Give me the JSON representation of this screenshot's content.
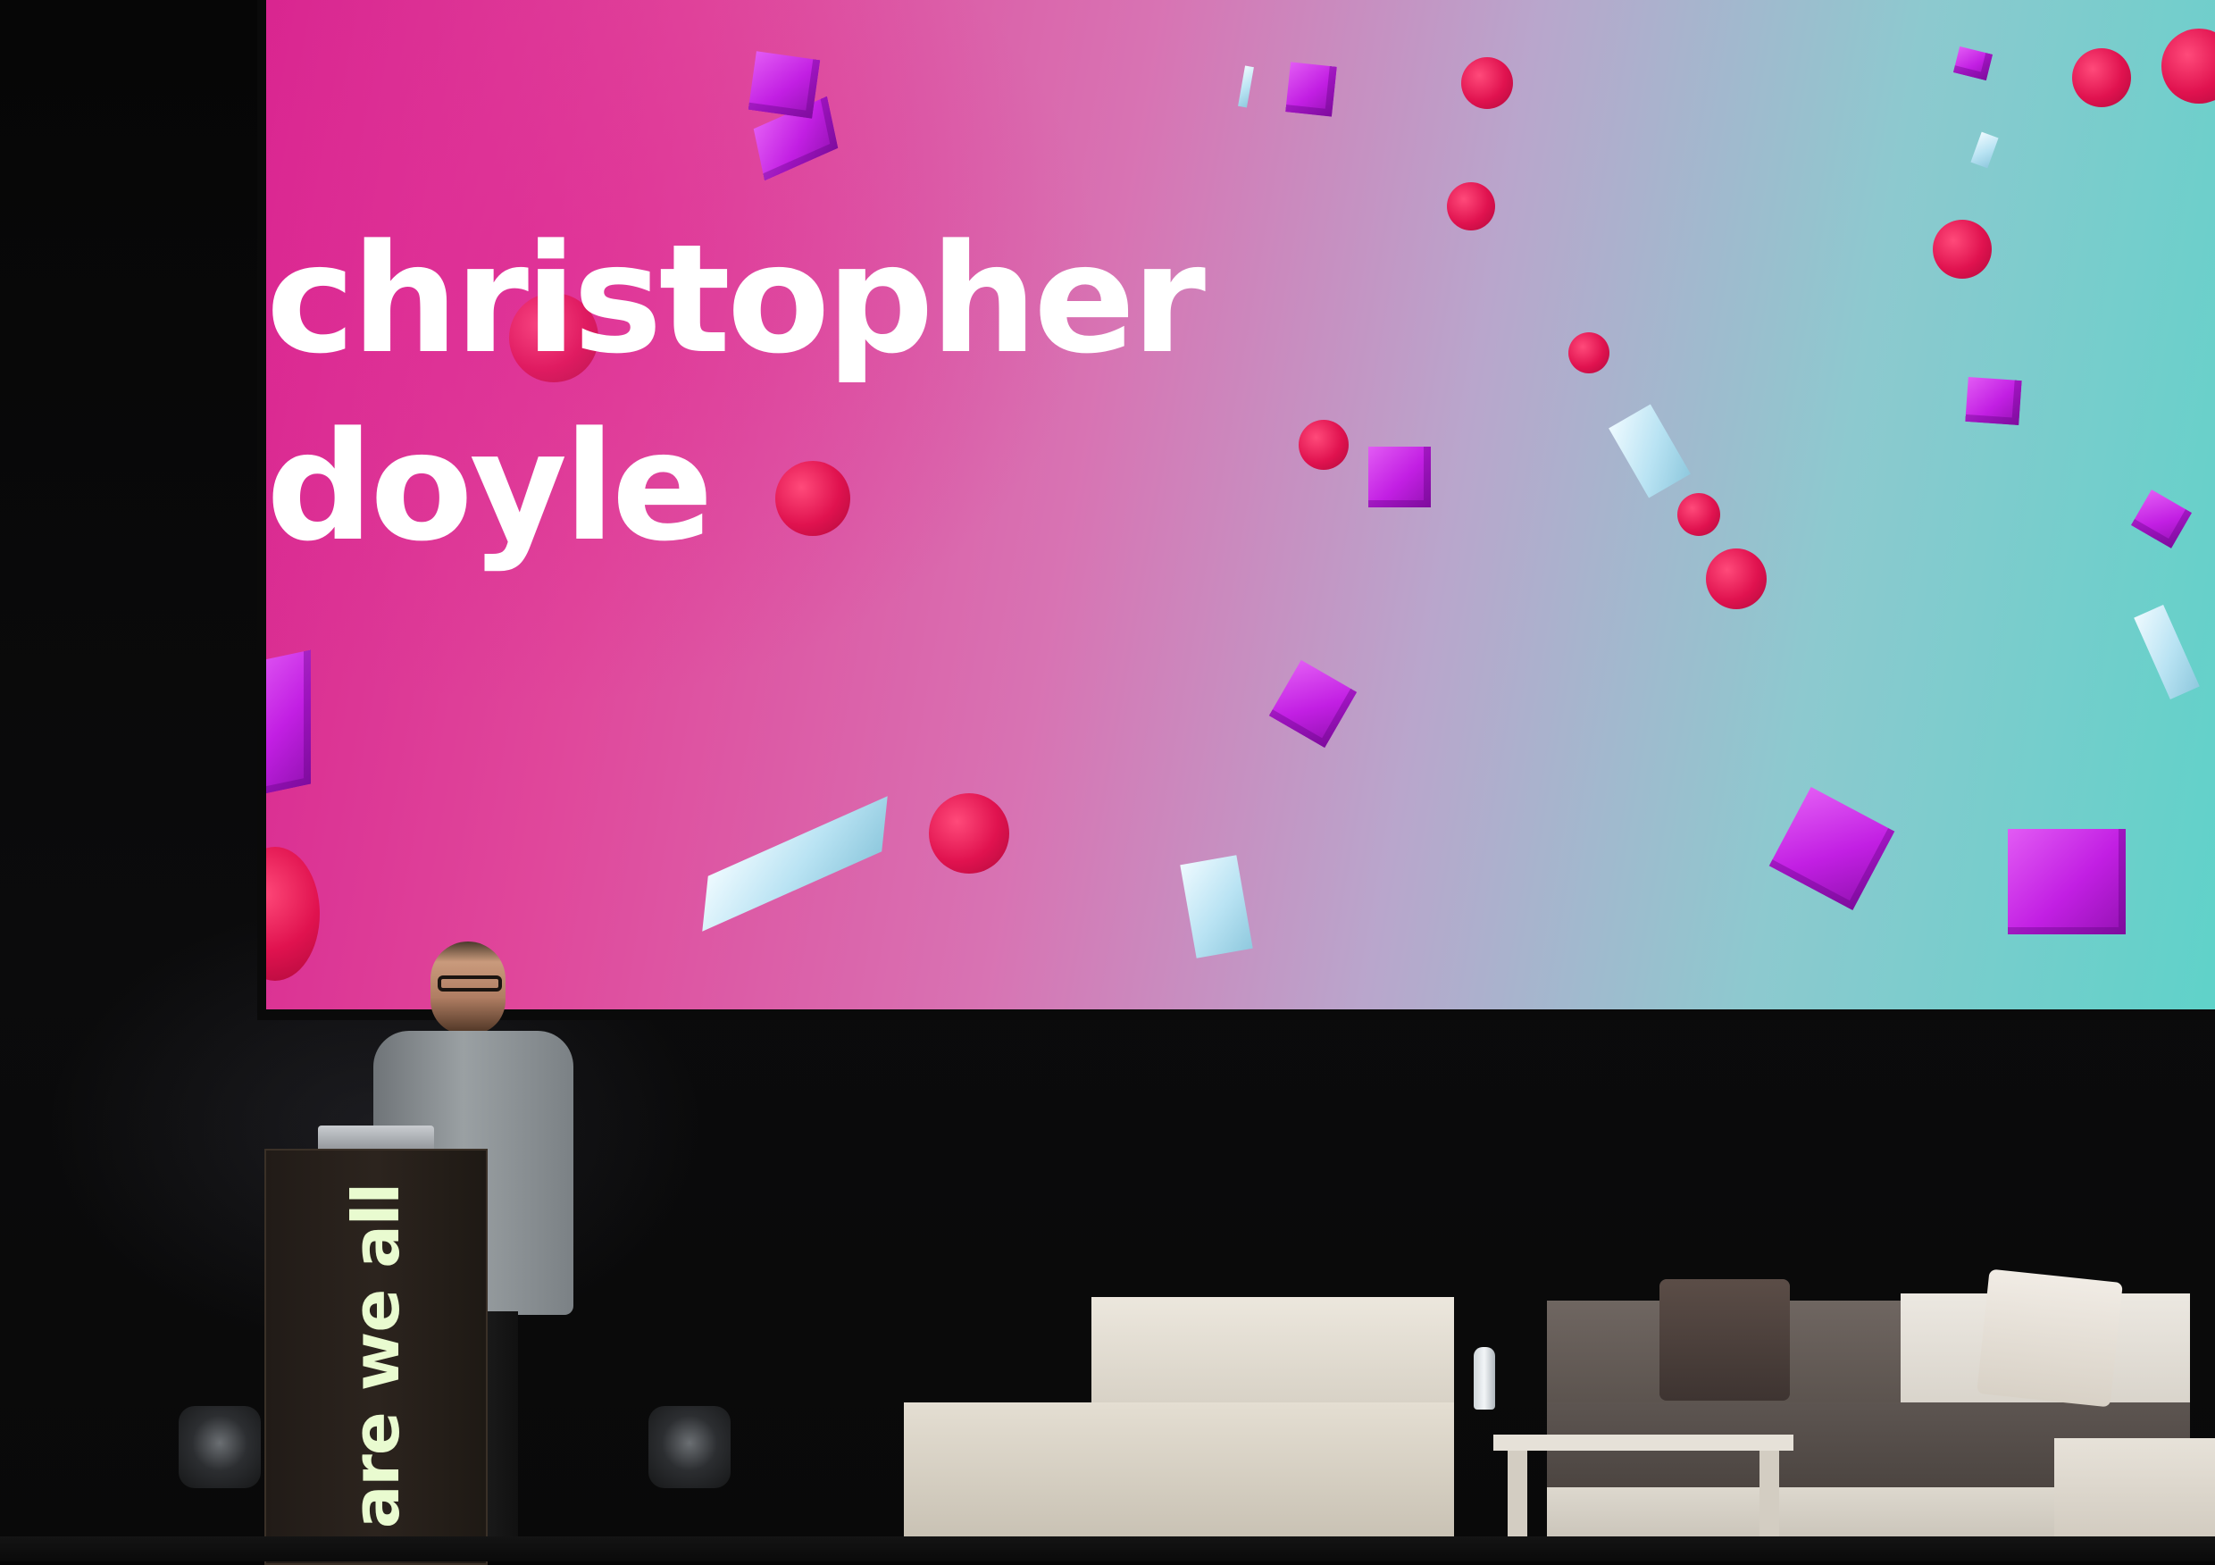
{
  "slide": {
    "title": "christopher\ndoyle",
    "background_gradient": [
      "#d8258f",
      "#d873b3",
      "#5fd2c9"
    ]
  },
  "podium": {
    "label": "are we all",
    "label_color": "#e9fbd0"
  },
  "colors": {
    "sphere": "#e0124f",
    "cube": "#c21fe3",
    "shard": "#b9e3f3",
    "stage": "#050505"
  }
}
